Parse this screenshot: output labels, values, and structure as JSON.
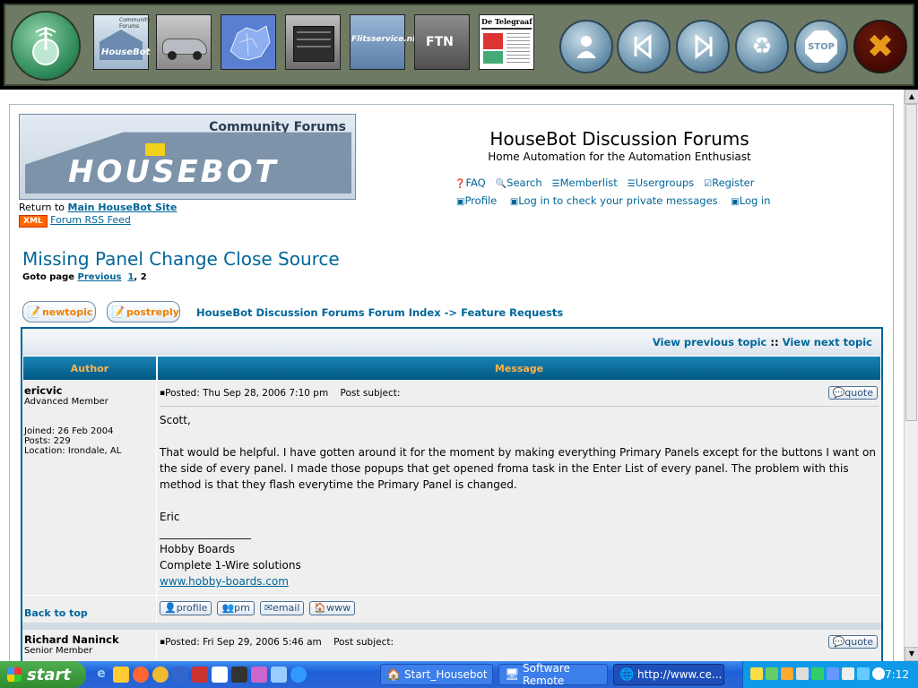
{
  "toolbar": {
    "thumbs": [
      "",
      "",
      "",
      "",
      "",
      "",
      ""
    ],
    "thumb_housebot_text": "HouseBot",
    "thumb_housebot_subtext": "Community Forums",
    "thumb_flits_text": "Flitsservice.nl",
    "thumb_ftn_text": "FTN",
    "thumb_telegraaf_text": "De Telegraaf",
    "stop_label": "STOP"
  },
  "header": {
    "logo_tag": "Community Forums",
    "logo_text": "HouseBot",
    "return_prefix": "Return to",
    "return_link": "Main HouseBot Site",
    "xml_badge": "XML",
    "rss_link": "Forum RSS Feed",
    "site_title": "HouseBot Discussion Forums",
    "site_subtitle": "Home Automation for the Automation Enthusiast",
    "nav": [
      "FAQ",
      "Search",
      "Memberlist",
      "Usergroups",
      "Register"
    ],
    "nav2": [
      "Profile",
      "Log in to check your private messages",
      "Log in"
    ]
  },
  "topic": {
    "title": "Missing Panel Change Close Source",
    "goto_prefix": "Goto page",
    "goto_prev": "Previous",
    "goto_page1": "1",
    "goto_sep": ",",
    "goto_page2": "2",
    "newtopic": "newtopic",
    "postreply": "postreply",
    "breadcrumb_index": "HouseBot Discussion Forums Forum Index",
    "breadcrumb_arrow": "->",
    "breadcrumb_forum": "Feature Requests",
    "view_prev": "View previous topic",
    "view_sep": "::",
    "view_next": "View next topic",
    "col_author": "Author",
    "col_message": "Message"
  },
  "posts": [
    {
      "author": "ericvic",
      "rank": "Advanced Member",
      "joined": "Joined: 26 Feb 2004",
      "posts": "Posts: 229",
      "location": "Location: Irondale, AL",
      "posted": "Posted: Thu Sep 28, 2006 7:10 pm",
      "subject": "Post subject:",
      "quote": "quote",
      "line1": "Scott,",
      "line2": "That would be helpful. I have gotten around it for the moment by making everything Primary Panels except for the buttons I want on the side of every panel. I made those popups that get opened froma task in the Enter List of every panel. The problem with this method is that they flash everytime the Primary Panel is changed.",
      "line3": "Eric",
      "sig_line": "_________________",
      "sig1": "Hobby Boards",
      "sig2": "Complete 1-Wire solutions",
      "sig_link": "www.hobby-boards.com",
      "back_to_top": "Back to top",
      "buttons": [
        "profile",
        "pm",
        "email",
        "www"
      ]
    },
    {
      "author": "Richard Naninck",
      "rank": "Senior Member",
      "posted": "Posted: Fri Sep 29, 2006 5:46 am",
      "subject": "Post subject:",
      "quote": "quote"
    }
  ],
  "taskbar": {
    "start": "start",
    "tasks": [
      "Start_Housebot",
      "Software Remote",
      "http://www.ce..."
    ],
    "clock": "17:12"
  }
}
